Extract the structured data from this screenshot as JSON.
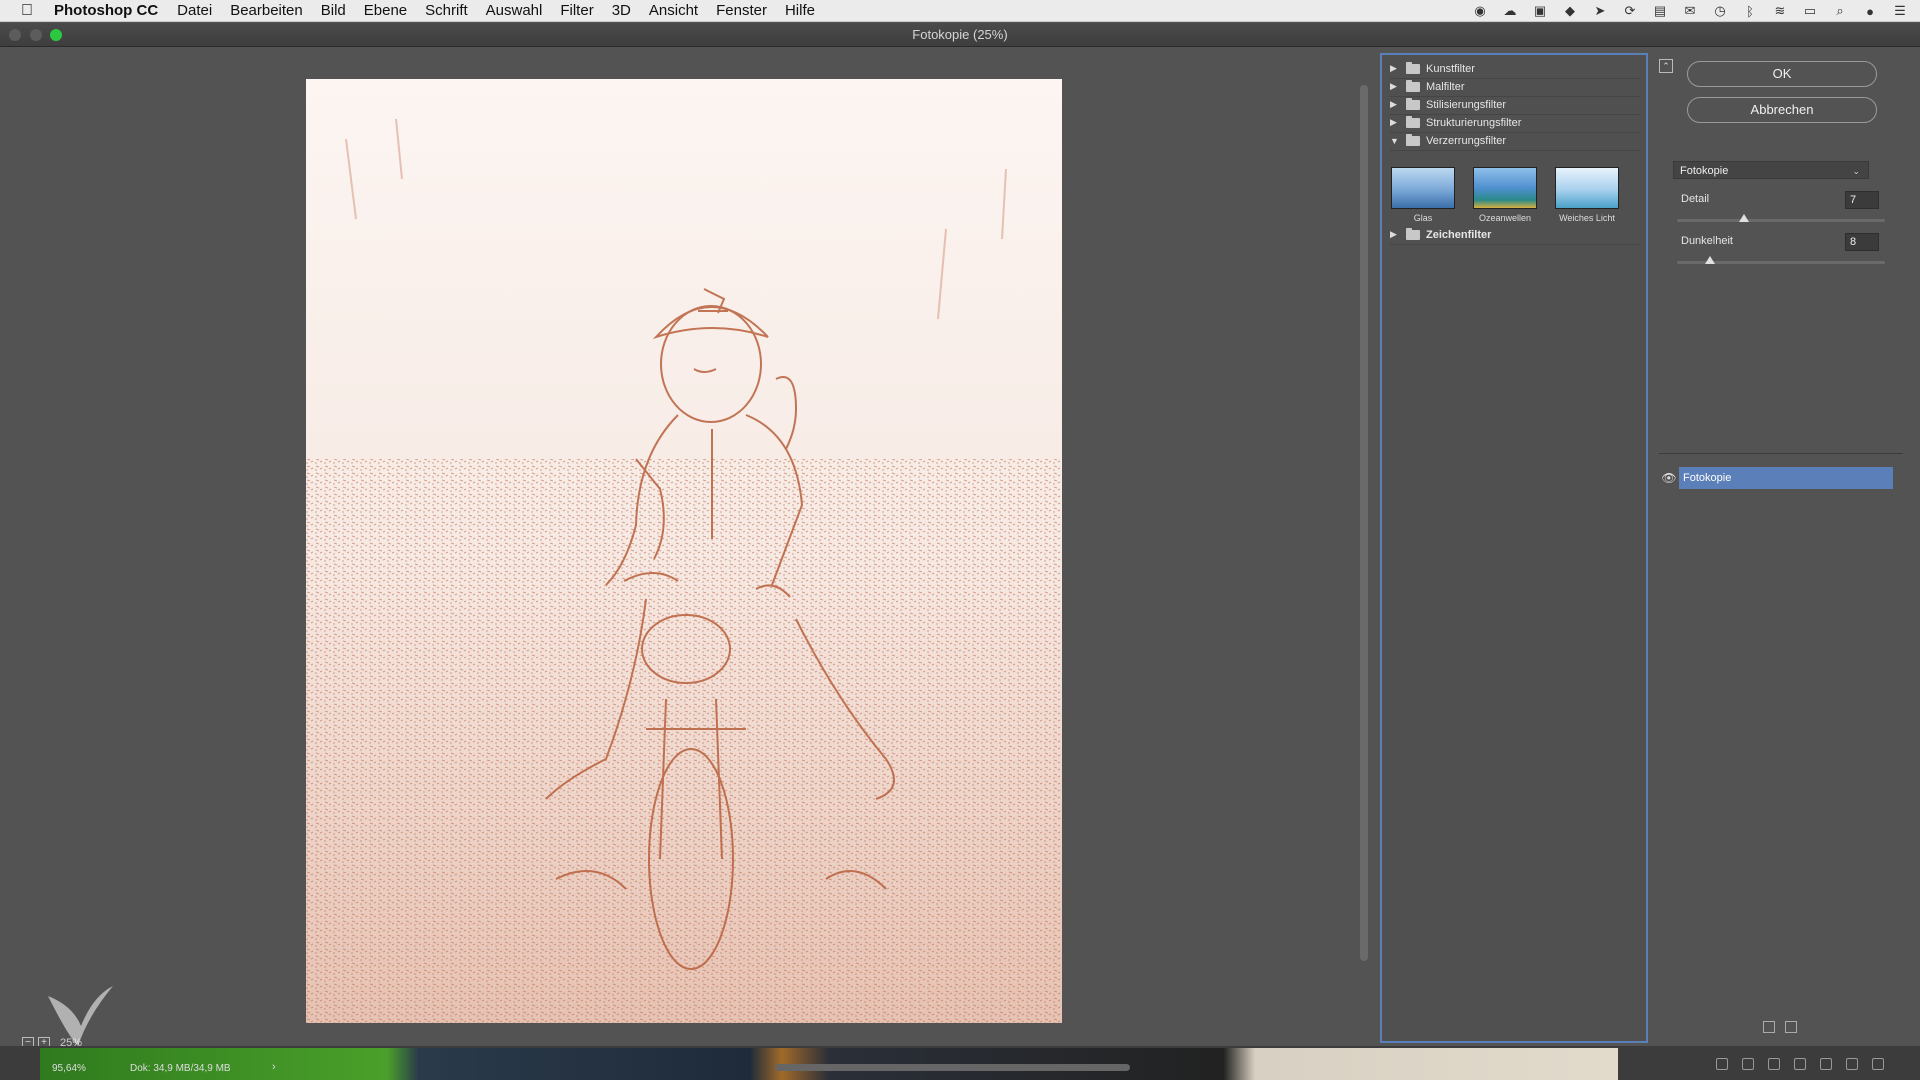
{
  "menubar": {
    "app_name": "Photoshop CC",
    "items": [
      "Datei",
      "Bearbeiten",
      "Bild",
      "Ebene",
      "Schrift",
      "Auswahl",
      "Filter",
      "3D",
      "Ansicht",
      "Fenster",
      "Hilfe"
    ]
  },
  "window": {
    "title": "Fotokopie (25%)"
  },
  "preview": {
    "zoom_label": "25%"
  },
  "filter_gallery": {
    "categories": [
      {
        "label": "Kunstfilter",
        "expanded": false
      },
      {
        "label": "Malfilter",
        "expanded": false
      },
      {
        "label": "Stilisierungsfilter",
        "expanded": false
      },
      {
        "label": "Strukturierungsfilter",
        "expanded": false
      },
      {
        "label": "Verzerrungsfilter",
        "expanded": true
      },
      {
        "label": "Zeichenfilter",
        "expanded": false
      }
    ],
    "thumbnails": [
      {
        "label": "Glas"
      },
      {
        "label": "Ozeanwellen"
      },
      {
        "label": "Weiches Licht"
      }
    ]
  },
  "settings": {
    "ok_label": "OK",
    "cancel_label": "Abbrechen",
    "selected_filter": "Fotokopie",
    "params": [
      {
        "label": "Detail",
        "value": "7",
        "fraction": 0.32
      },
      {
        "label": "Dunkelheit",
        "value": "8",
        "fraction": 0.16
      }
    ],
    "layer_name": "Fotokopie"
  },
  "status": {
    "zoom": "95,64%",
    "doc": "Dok: 34,9 MB/34,9 MB",
    "arrow": "›"
  },
  "colors": {
    "accent": "#5b7fb8",
    "sketch": "#c06a48"
  }
}
